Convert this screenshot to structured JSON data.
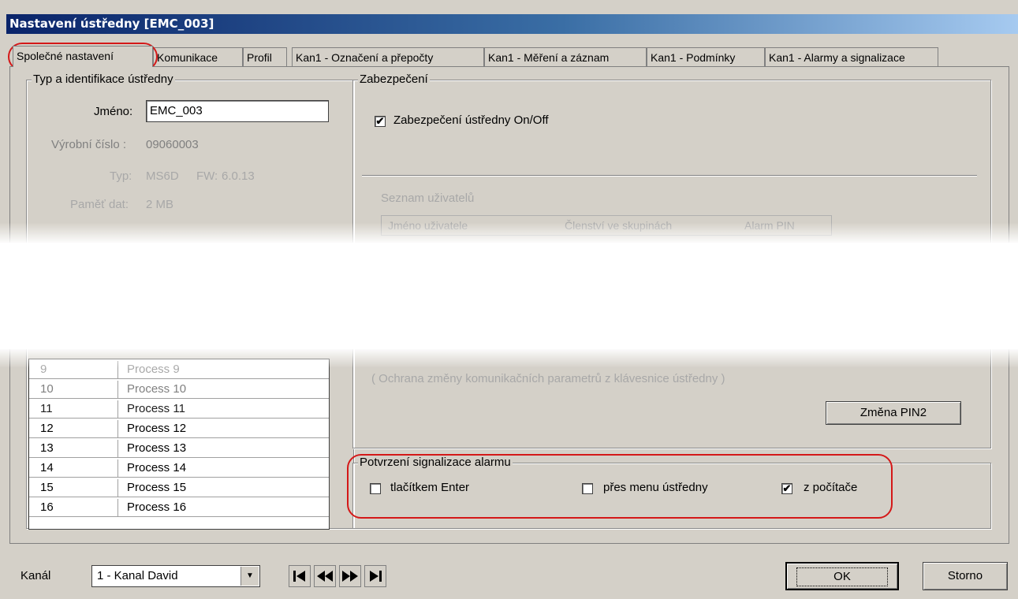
{
  "window": {
    "title": "Nastavení ústředny [EMC_003]"
  },
  "tabs": [
    "Společné nastavení",
    "Komunikace",
    "Profil",
    "Kan1 - Označení a přepočty",
    "Kan1 - Měření a záznam",
    "Kan1 - Podmínky",
    "Kan1 - Alarmy a signalizace"
  ],
  "typ": {
    "legend": "Typ a identifikace ústředny",
    "name_label": "Jméno:",
    "name_value": "EMC_003",
    "serial_label": "Výrobní číslo :",
    "serial_value": "09060003",
    "type_label": "Typ:",
    "type_value": "MS6D",
    "fw_label": "FW:",
    "fw_value": "6.0.13",
    "mem_label": "Paměť dat:",
    "mem_value": "2 MB"
  },
  "processes": [
    {
      "num": "9",
      "name": "Process 9"
    },
    {
      "num": "10",
      "name": "Process 10"
    },
    {
      "num": "11",
      "name": "Process 11"
    },
    {
      "num": "12",
      "name": "Process 12"
    },
    {
      "num": "13",
      "name": "Process 13"
    },
    {
      "num": "14",
      "name": "Process 14"
    },
    {
      "num": "15",
      "name": "Process 15"
    },
    {
      "num": "16",
      "name": "Process 16"
    }
  ],
  "security": {
    "legend": "Zabezpečení",
    "enable_label": "Zabezpečení ústředny On/Off",
    "enable_checked": true,
    "users_label": "Seznam uživatelů",
    "users_columns": [
      "Jméno uživatele",
      "Členství ve skupinách",
      "Alarm PIN"
    ],
    "pin2_note": "( Ochrana změny komunikačních parametrů z klávesnice ústředny )",
    "pin2_button": "Změna PIN2"
  },
  "alarm_confirm": {
    "legend": "Potvrzení signalizace alarmu",
    "options": [
      {
        "label": "tlačítkem Enter",
        "checked": false
      },
      {
        "label": "přes menu ústředny",
        "checked": false
      },
      {
        "label": "z počítače",
        "checked": true
      }
    ]
  },
  "footer": {
    "channel_label": "Kanál",
    "channel_value": "1 - Kanal David",
    "ok": "OK",
    "cancel": "Storno"
  },
  "icons": [
    "first-icon",
    "prev-icon",
    "next-icon",
    "last-icon",
    "combo-arrow-icon",
    "checkmark-icon"
  ],
  "colors": {
    "title_start": "#0a246a",
    "title_end": "#a6caf0",
    "highlight": "#d41818",
    "face": "#d4d0c8"
  }
}
